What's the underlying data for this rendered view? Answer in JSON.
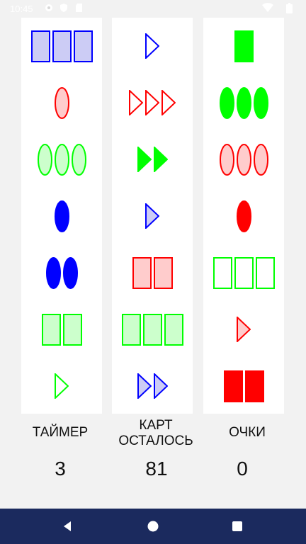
{
  "status_bar": {
    "time": "10:45",
    "icons": [
      "gear-icon",
      "shield-icon",
      "sd-card-icon",
      "wifi-icon",
      "battery-icon"
    ]
  },
  "colors": {
    "blue": "#0000ff",
    "blue_fill": "#ccccf5",
    "red": "#ff0000",
    "red_fill": "#ffcccc",
    "green": "#00ff00",
    "green_fill": "#ccffcc"
  },
  "board": {
    "columns": [
      [
        {
          "count": 3,
          "shape": "rectangle",
          "fill": "striped",
          "color": "blue"
        },
        {
          "count": 1,
          "shape": "oval",
          "fill": "striped",
          "color": "red"
        },
        {
          "count": 3,
          "shape": "oval",
          "fill": "striped",
          "color": "green"
        },
        {
          "count": 1,
          "shape": "oval",
          "fill": "solid",
          "color": "blue"
        },
        {
          "count": 2,
          "shape": "oval",
          "fill": "solid",
          "color": "blue"
        },
        {
          "count": 2,
          "shape": "rectangle",
          "fill": "striped",
          "color": "green"
        },
        {
          "count": 1,
          "shape": "triangle",
          "fill": "empty",
          "color": "green"
        }
      ],
      [
        {
          "count": 1,
          "shape": "triangle",
          "fill": "empty",
          "color": "blue"
        },
        {
          "count": 3,
          "shape": "triangle",
          "fill": "empty",
          "color": "red"
        },
        {
          "count": 2,
          "shape": "triangle",
          "fill": "solid",
          "color": "green"
        },
        {
          "count": 1,
          "shape": "triangle",
          "fill": "striped",
          "color": "blue"
        },
        {
          "count": 2,
          "shape": "rectangle",
          "fill": "striped",
          "color": "red"
        },
        {
          "count": 3,
          "shape": "rectangle",
          "fill": "striped",
          "color": "green"
        },
        {
          "count": 2,
          "shape": "triangle",
          "fill": "striped",
          "color": "blue"
        }
      ],
      [
        {
          "count": 1,
          "shape": "rectangle",
          "fill": "solid",
          "color": "green"
        },
        {
          "count": 3,
          "shape": "oval",
          "fill": "solid",
          "color": "green"
        },
        {
          "count": 3,
          "shape": "oval",
          "fill": "striped",
          "color": "red"
        },
        {
          "count": 1,
          "shape": "oval",
          "fill": "solid",
          "color": "red"
        },
        {
          "count": 3,
          "shape": "rectangle",
          "fill": "empty",
          "color": "green"
        },
        {
          "count": 1,
          "shape": "triangle",
          "fill": "striped",
          "color": "red"
        },
        {
          "count": 2,
          "shape": "rectangle",
          "fill": "solid",
          "color": "red"
        }
      ]
    ]
  },
  "stats": {
    "timer_label": "ТАЙМЕР",
    "cards_left_label_line1": "КАРТ",
    "cards_left_label_line2": "ОСТАЛОСЬ",
    "score_label": "ОЧКИ",
    "timer_value": "3",
    "cards_left_value": "81",
    "score_value": "0"
  },
  "nav_bar": {
    "icons": [
      "back-icon",
      "home-icon",
      "recents-icon"
    ]
  }
}
